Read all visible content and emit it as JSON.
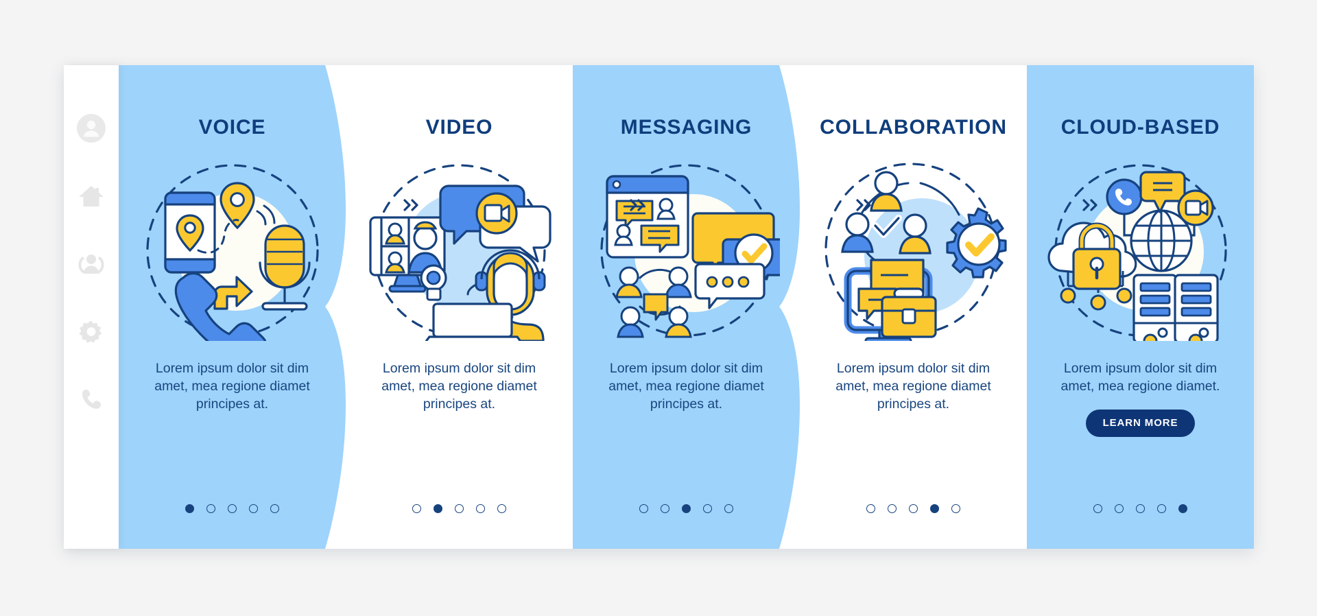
{
  "app": {
    "background_color": "#f4f4f4",
    "card_background": "#ffffff",
    "accent_blue": "#9ed3fb",
    "title_color": "#0f3d7c",
    "button_color": "#0e3576"
  },
  "sidebar": {
    "items": [
      {
        "name": "avatar",
        "icon": "user-circle-icon"
      },
      {
        "name": "home",
        "icon": "home-icon"
      },
      {
        "name": "contacts",
        "icon": "people-group-icon"
      },
      {
        "name": "settings",
        "icon": "gear-icon"
      },
      {
        "name": "calls",
        "icon": "phone-handset-icon"
      }
    ]
  },
  "separators": [
    {
      "icon": "double-chevron-right-icon",
      "glyph": "»"
    },
    {
      "icon": "double-chevron-right-icon",
      "glyph": "»"
    },
    {
      "icon": "double-chevron-right-icon",
      "glyph": "»"
    },
    {
      "icon": "double-chevron-right-icon",
      "glyph": "»"
    }
  ],
  "panels": [
    {
      "title": "VOICE",
      "description": "Lorem ipsum dolor sit dim amet, mea regione diamet principes at.",
      "illustration": "voice-call-illustration",
      "theme": "blue",
      "dots": {
        "count": 5,
        "active": 1
      },
      "button": null
    },
    {
      "title": "VIDEO",
      "description": "Lorem ipsum dolor sit dim amet, mea regione diamet principes at.",
      "illustration": "video-conference-illustration",
      "theme": "white",
      "dots": {
        "count": 5,
        "active": 2
      },
      "button": null
    },
    {
      "title": "MESSAGING",
      "description": "Lorem ipsum dolor sit dim amet, mea regione diamet principes at.",
      "illustration": "messaging-chat-illustration",
      "theme": "blue",
      "dots": {
        "count": 5,
        "active": 3
      },
      "button": null
    },
    {
      "title": "COLLABORATION",
      "description": "Lorem ipsum dolor sit dim amet, mea regione diamet principes at.",
      "illustration": "collaboration-teamwork-illustration",
      "theme": "white",
      "dots": {
        "count": 5,
        "active": 4
      },
      "button": null
    },
    {
      "title": "CLOUD-BASED",
      "description": "Lorem ipsum dolor sit dim amet, mea regione diamet.",
      "illustration": "cloud-security-illustration",
      "theme": "blue",
      "dots": {
        "count": 5,
        "active": 5
      },
      "button": "LEARN MORE"
    }
  ]
}
